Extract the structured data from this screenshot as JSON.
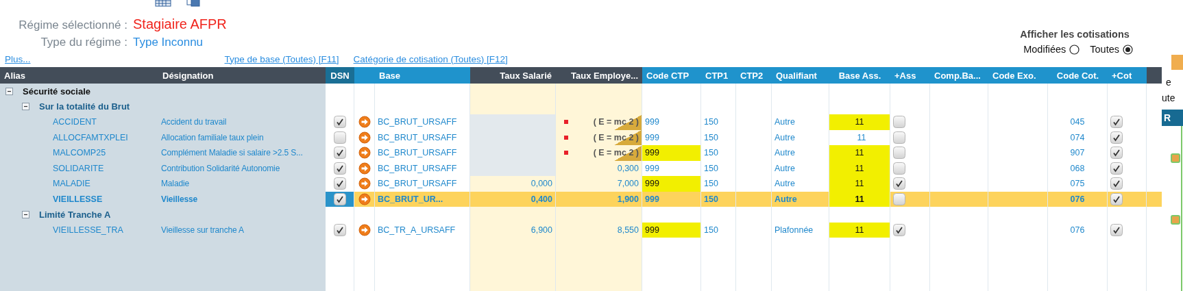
{
  "regime": {
    "label": "Régime sélectionné :",
    "value": "Stagiaire AFPR"
  },
  "type_regime": {
    "label": "Type du régime :",
    "value": "Type Inconnu"
  },
  "links": [
    "Plus...",
    "Type de base (Toutes) [F11]",
    "Catégorie de cotisation (Toutes) [F12]"
  ],
  "display_filter": {
    "title": "Afficher les cotisations",
    "options": [
      {
        "label": "Modifiées",
        "selected": false
      },
      {
        "label": "Toutes",
        "selected": true
      }
    ]
  },
  "table": {
    "columns": [
      "Alias",
      "Désignation",
      "DSN",
      "Base",
      "Taux Salarié",
      "Taux Employe...",
      "Code CTP",
      "CTP1",
      "CTP2",
      "Qualifiant",
      "Base Ass.",
      "+Ass",
      "Comp.Ba...",
      "Code Exo.",
      "Code Cot.",
      "+Cot"
    ],
    "groups": [
      {
        "label": "Sécurité sociale",
        "expanded": true,
        "children": [
          {
            "label": "Sur la totalité du Brut",
            "expanded": true,
            "rows": [
              {
                "alias": "ACCIDENT",
                "designation": "Accident du travail",
                "dsn": true,
                "base": "BC_BRUT_URSAFF",
                "taux_salarie_disabled": true,
                "taux_employeur": {
                  "kind": "formula",
                  "text": "( E = mc 2 )"
                },
                "code_ctp": "999",
                "code_ctp_highlighted": false,
                "ctp1": "150",
                "qualifiant": "Autre",
                "base_ass": "11",
                "base_ass_highlighted": true,
                "plus_ass": false,
                "code_cot": "045",
                "plus_cot": true,
                "selected": false
              },
              {
                "alias": "ALLOCFAMTXPLEI",
                "designation": "Allocation familiale taux plein",
                "dsn": false,
                "base": "BC_BRUT_URSAFF",
                "taux_salarie_disabled": true,
                "taux_employeur": {
                  "kind": "formula",
                  "text": "( E = mc 2 )"
                },
                "code_ctp": "999",
                "code_ctp_highlighted": false,
                "ctp1": "150",
                "qualifiant": "Autre",
                "base_ass": "11",
                "base_ass_highlighted": false,
                "plus_ass": false,
                "code_cot": "074",
                "plus_cot": true,
                "selected": false
              },
              {
                "alias": "MALCOMP25",
                "designation": "Complément Maladie si salaire >2.5 S...",
                "dsn": true,
                "base": "BC_BRUT_URSAFF",
                "taux_salarie_disabled": true,
                "taux_employeur": {
                  "kind": "formula",
                  "text": "( E = mc 2 )"
                },
                "code_ctp": "999",
                "code_ctp_highlighted": true,
                "ctp1": "150",
                "qualifiant": "Autre",
                "base_ass": "11",
                "base_ass_highlighted": true,
                "plus_ass": false,
                "code_cot": "907",
                "plus_cot": true,
                "selected": false
              },
              {
                "alias": "SOLIDARITE",
                "designation": "Contribution Solidarité Autonomie",
                "dsn": true,
                "base": "BC_BRUT_URSAFF",
                "taux_salarie_disabled": true,
                "taux_employeur": {
                  "kind": "value",
                  "text": "0,300"
                },
                "code_ctp": "999",
                "code_ctp_highlighted": false,
                "ctp1": "150",
                "qualifiant": "Autre",
                "base_ass": "11",
                "base_ass_highlighted": true,
                "plus_ass": false,
                "code_cot": "068",
                "plus_cot": true,
                "selected": false
              },
              {
                "alias": "MALADIE",
                "designation": "Maladie",
                "dsn": true,
                "base": "BC_BRUT_URSAFF",
                "taux_salarie": "0,000",
                "taux_employeur": {
                  "kind": "value",
                  "text": "7,000"
                },
                "code_ctp": "999",
                "code_ctp_highlighted": true,
                "ctp1": "150",
                "qualifiant": "Autre",
                "base_ass": "11",
                "base_ass_highlighted": true,
                "plus_ass": true,
                "code_cot": "075",
                "plus_cot": true,
                "selected": false
              },
              {
                "alias": "VIEILLESSE",
                "designation": "Vieillesse",
                "dsn": true,
                "base": "BC_BRUT_UR...",
                "taux_salarie": "0,400",
                "taux_employeur": {
                  "kind": "value",
                  "text": "1,900"
                },
                "code_ctp": "999",
                "code_ctp_highlighted": false,
                "ctp1": "150",
                "qualifiant": "Autre",
                "base_ass": "11",
                "base_ass_highlighted": true,
                "plus_ass": false,
                "code_cot": "076",
                "plus_cot": true,
                "selected": true
              }
            ]
          },
          {
            "label": "Limité Tranche A",
            "expanded": true,
            "rows": [
              {
                "alias": "VIEILLESSE_TRA",
                "designation": "Vieillesse sur tranche A",
                "dsn": true,
                "base": "BC_TR_A_URSAFF",
                "taux_salarie": "6,900",
                "taux_employeur": {
                  "kind": "value",
                  "text": "8,550"
                },
                "code_ctp": "999",
                "code_ctp_highlighted": true,
                "ctp1": "150",
                "qualifiant": "Plafonnée",
                "base_ass": "11",
                "base_ass_highlighted": true,
                "plus_ass": true,
                "code_cot": "076",
                "plus_cot": true,
                "selected": false
              }
            ]
          }
        ]
      }
    ]
  },
  "side_panel": {
    "texts": [
      "e",
      "ute"
    ],
    "header": "R"
  }
}
